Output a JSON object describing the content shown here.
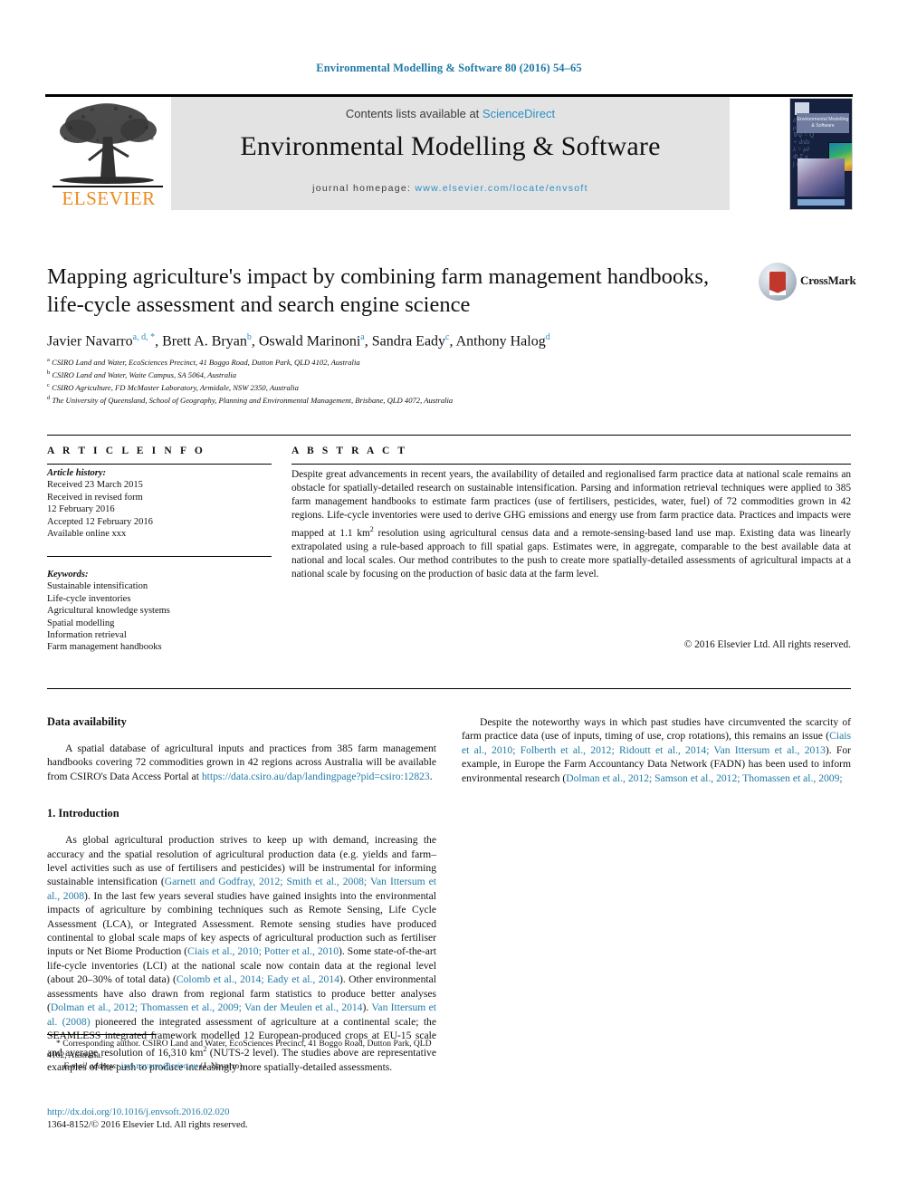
{
  "running_head": "Environmental Modelling & Software 80 (2016) 54–65",
  "masthead": {
    "contents_prefix": "Contents lists available at ",
    "contents_link": "ScienceDirect",
    "journal_title": "Environmental Modelling & Software",
    "homepage_prefix": "journal homepage: ",
    "homepage_url": "www.elsevier.com/locate/envsoft",
    "publisher_name": "ELSEVIER",
    "cover_title": "Environmental Modelling & Software",
    "link_color": "#2b90c4",
    "publisher_color": "#eb8b1e"
  },
  "article": {
    "title": "Mapping agriculture's impact by combining farm management handbooks, life-cycle assessment and search engine science",
    "crossmark_label": "CrossMark",
    "authors": [
      {
        "name": "Javier Navarro",
        "marks": "a, d, *"
      },
      {
        "name": "Brett A. Bryan",
        "marks": "b"
      },
      {
        "name": "Oswald Marinoni",
        "marks": "a"
      },
      {
        "name": "Sandra Eady",
        "marks": "c"
      },
      {
        "name": "Anthony Halog",
        "marks": "d"
      }
    ],
    "affiliations": [
      {
        "mark": "a",
        "text": "CSIRO Land and Water, EcoSciences Precinct, 41 Boggo Road, Dutton Park, QLD 4102, Australia"
      },
      {
        "mark": "b",
        "text": "CSIRO Land and Water, Waite Campus, SA 5064, Australia"
      },
      {
        "mark": "c",
        "text": "CSIRO Agriculture, FD McMaster Laboratory, Armidale, NSW 2350, Australia"
      },
      {
        "mark": "d",
        "text": "The University of Queensland, School of Geography, Planning and Environmental Management, Brisbane, QLD 4072, Australia"
      }
    ]
  },
  "article_info": {
    "heading": "A R T I C L E  I N F O",
    "history_label": "Article history:",
    "history": [
      "Received 23 March 2015",
      "Received in revised form",
      "12 February 2016",
      "Accepted 12 February 2016",
      "Available online xxx"
    ],
    "keywords_label": "Keywords:",
    "keywords": [
      "Sustainable intensification",
      "Life-cycle inventories",
      "Agricultural knowledge systems",
      "Spatial modelling",
      "Information retrieval",
      "Farm management handbooks"
    ]
  },
  "abstract": {
    "heading": "A B S T R A C T",
    "body_part1": "Despite great advancements in recent years, the availability of detailed and regionalised farm practice data at national scale remains an obstacle for spatially-detailed research on sustainable intensification. Parsing and information retrieval techniques were applied to 385 farm management handbooks to estimate farm practices (use of fertilisers, pesticides, water, fuel) of 72 commodities grown in 42 regions. Life-cycle inventories were used to derive GHG emissions and energy use from farm practice data. Practices and impacts were mapped at 1.1 km",
    "body_sup": "2",
    "body_part2": " resolution using agricultural census data and a remote-sensing-based land use map. Existing data was linearly extrapolated using a rule-based approach to fill spatial gaps. Estimates were, in aggregate, comparable to the best available data at national and local scales. Our method contributes to the push to create more spatially-detailed assessments of agricultural impacts at a national scale by focusing on the production of basic data at the farm level.",
    "copyright": "© 2016 Elsevier Ltd. All rights reserved."
  },
  "body": {
    "data_availability": {
      "heading": "Data availability",
      "p1_before": "A spatial database of agricultural inputs and practices from 385 farm management handbooks covering 72 commodities grown in 42 regions across Australia will be available from CSIRO's Data Access Portal at ",
      "p1_link": "https://data.csiro.au/dap/landingpage?pid=csiro:12823",
      "p1_after": "."
    },
    "introduction": {
      "heading": "1. Introduction",
      "p1_a": "As global agricultural production strives to keep up with demand, increasing the accuracy and the spatial resolution of agricultural production data (e.g. yields and farm–level activities such as use of fertilisers and pesticides) will be instrumental for informing sustainable intensification (",
      "p1_ref": "Garnett and Godfray, 2012; Smith et al., 2008; Van Ittersum et al., 2008",
      "p1_b": "). In the last few years several studies have gained insights into the environmental impacts of agriculture by combining techniques such as Remote Sensing, Life Cycle Assessment (LCA), or Integrated Assessment. Remote sensing studies have produced continental to global scale maps of key aspects of agricultural production such as fertiliser inputs or Net Biome Production (",
      "p1_ref2": "Ciais et al., 2010; Potter et al., 2010",
      "p1_c": "). Some state-of-the-art life-cycle inventories (LCI) at the national scale now contain data at the regional level (about 20–30% of total data) (",
      "p1_ref3": "Colomb et al., 2014; Eady et al., 2014",
      "p1_d": "). Other environmental assessments have also drawn from regional farm statistics to produce better analyses (",
      "p1_ref4": "Dolman et al., 2012; Thomassen et al., 2009; Van der Meulen et al., 2014",
      "p1_e": "). ",
      "p1_ref5": "Van Ittersum et al. (2008)",
      "p1_f": " pioneered the integrated assessment of agriculture at a continental scale; the SEAMLESS integrated framework modelled 12 European-produced crops at EU-15 scale and average resolution of 16,310 km",
      "p1_sup": "2",
      "p1_g": " (NUTS-2 level). The studies above are representative examples of the push to produce increasingly more spatially-detailed assessments.",
      "p2_a": "Despite the noteworthy ways in which past studies have circumvented the scarcity of farm practice data (use of inputs, timing of use, crop rotations), this remains an issue (",
      "p2_ref": "Ciais et al., 2010; Folberth et al., 2012; Ridoutt et al., 2014; Van Ittersum et al., 2013",
      "p2_b": "). For example, in Europe the Farm Accountancy Data Network (FADN) has been used to inform environmental research (",
      "p2_ref2": "Dolman et al., 2012; Samson et al., 2012; Thomassen et al., 2009;"
    }
  },
  "footnote": {
    "corresponding": "* Corresponding author. CSIRO Land and Water, EcoSciences Precinct, 41 Boggo Road, Dutton Park, QLD 4102, Australia.",
    "email_label": "E-mail address:",
    "email": "javi.navarro@csiro.au",
    "email_suffix": "(J. Navarro)."
  },
  "imprint": {
    "doi": "http://dx.doi.org/10.1016/j.envsoft.2016.02.020",
    "issn_line": "1364-8152/© 2016 Elsevier Ltd. All rights reserved."
  }
}
